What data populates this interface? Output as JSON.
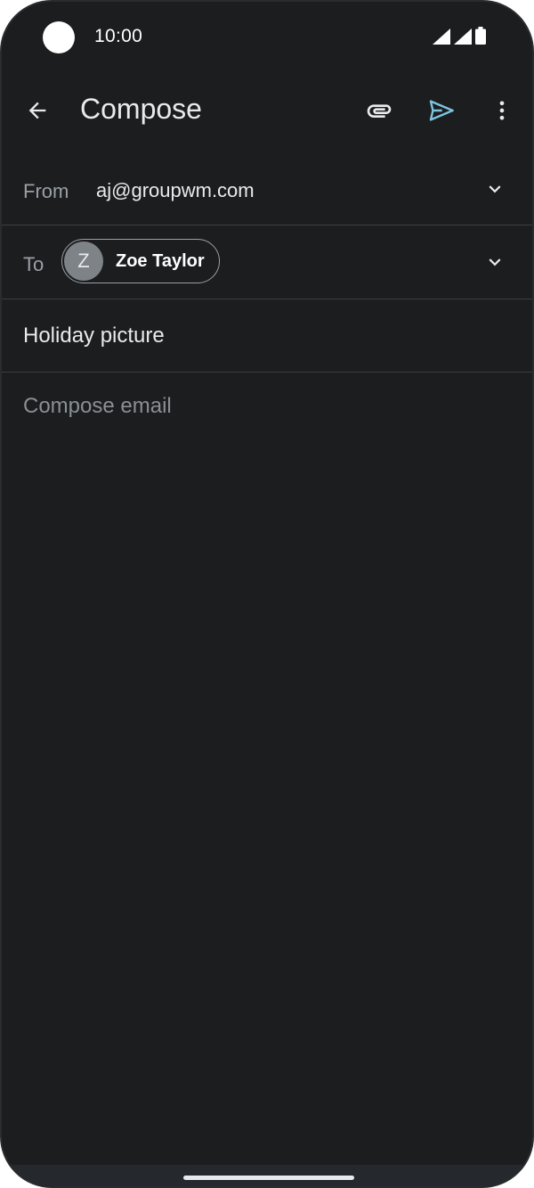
{
  "status_bar": {
    "time": "10:00",
    "icons": [
      "wifi-icon",
      "cellular-icon",
      "battery-icon"
    ]
  },
  "app_bar": {
    "title": "Compose",
    "back_icon": "arrow-back-icon",
    "attach_icon": "paperclip-icon",
    "send_icon": "send-icon",
    "more_icon": "more-vert-icon"
  },
  "from": {
    "label": "From",
    "value": "aj@groupwm.com"
  },
  "to": {
    "label": "To",
    "recipient": {
      "initial": "Z",
      "name": "Zoe Taylor"
    }
  },
  "subject": {
    "value": "Holiday picture"
  },
  "body": {
    "placeholder": "Compose email"
  },
  "colors": {
    "background": "#1c1d1f",
    "accent": "#7cc5e0",
    "text_primary": "#e8eaed",
    "text_secondary": "#9aa0a6",
    "divider": "#3c3e42"
  }
}
